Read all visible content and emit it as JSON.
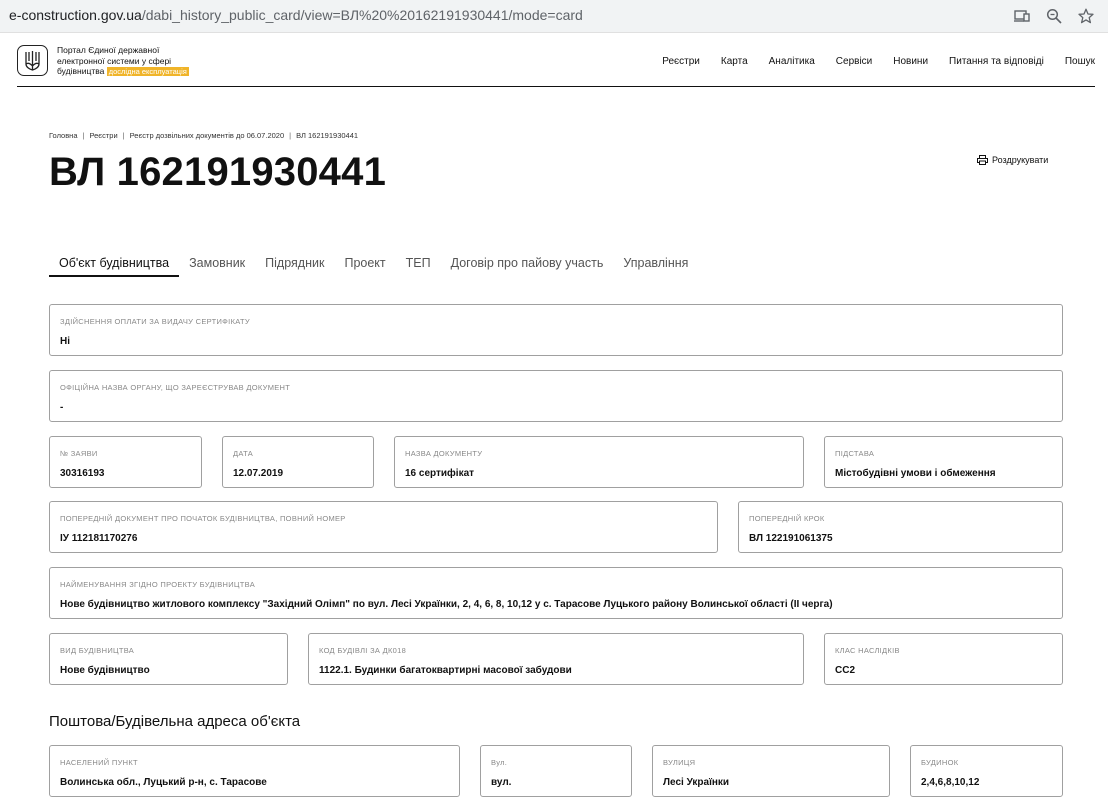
{
  "browser": {
    "url_host": "e-construction.gov.ua",
    "url_path": "/dabi_history_public_card/view=ВЛ%20%20162191930441/mode=card"
  },
  "header": {
    "portal_line1": "Портал Єдиної державної",
    "portal_line2": "електронної системи у сфері",
    "portal_line3": "будівництва",
    "badge": "дослідна експлуатація",
    "nav": [
      "Реєстри",
      "Карта",
      "Аналітика",
      "Сервіси",
      "Новини",
      "Питання та відповіді",
      "Пошук"
    ]
  },
  "breadcrumb": [
    "Головна",
    "Реєстри",
    "Реєстр дозвільних документів до 06.07.2020",
    "ВЛ 162191930441"
  ],
  "page": {
    "title": "ВЛ 162191930441",
    "print_label": "Роздрукувати"
  },
  "tabs": [
    "Об'єкт будівництва",
    "Замовник",
    "Підрядник",
    "Проект",
    "ТЕП",
    "Договір про пайову участь",
    "Управління"
  ],
  "fields": {
    "payment": {
      "label": "Здійснення оплати за видачу сертифікату",
      "value": "Ні"
    },
    "authority": {
      "label": "Офіційна назва органу, що зареєстрував документ",
      "value": "-"
    },
    "app_no": {
      "label": "№ заяви",
      "value": "30316193"
    },
    "date": {
      "label": "Дата",
      "value": "12.07.2019"
    },
    "doc_name": {
      "label": "Назва документу",
      "value": "16 сертифікат"
    },
    "basis": {
      "label": "Підстава",
      "value": "Містобудівні умови і обмеження"
    },
    "prev_doc": {
      "label": "Попередній документ про початок будівництва, повний номер",
      "value": "ІУ 112181170276"
    },
    "prev_step": {
      "label": "Попередній крок",
      "value": "ВЛ 122191061375"
    },
    "project_name": {
      "label": "Найменування згідно проекту будівництва",
      "value": "Нове будівництво житлового комплексу \"Західний Олімп\" по вул. Лесі Українки, 2, 4, 6, 8, 10,12 у с. Тарасове Луцького району Волинської області (ІІ черга)"
    },
    "build_type": {
      "label": "Вид будівництва",
      "value": "Нове будівництво"
    },
    "building_code": {
      "label": "Код будівлі за ДК018",
      "value": "1122.1. Будинки багатоквартирні масової забудови"
    },
    "consequence": {
      "label": "Клас наслідків",
      "value": "СС2"
    }
  },
  "address": {
    "heading": "Поштова/Будівельна адреса об'єкта",
    "settlement": {
      "label": "Населений пункт",
      "value": "Волинська обл., Луцький р-н, с. Тарасове"
    },
    "street_type": {
      "label": "Вул.",
      "value": "вул."
    },
    "street": {
      "label": "Вулиця",
      "value": "Лесі Українки"
    },
    "building": {
      "label": "Будинок",
      "value": "2,4,6,8,10,12"
    }
  }
}
